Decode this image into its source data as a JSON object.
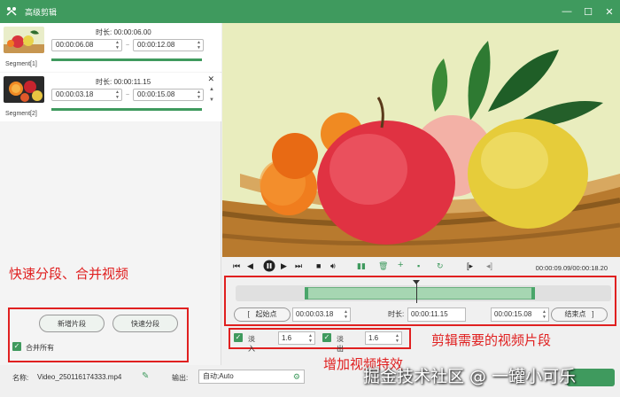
{
  "window": {
    "title": "高级剪辑",
    "controls": [
      "—",
      "☐",
      "✕"
    ]
  },
  "segments": [
    {
      "label": "Segment[1]",
      "duration_label": "时长:",
      "duration": "00:00:06.00",
      "start": "00:00:06.08",
      "end": "00:00:12.08"
    },
    {
      "label": "Segment[2]",
      "duration_label": "时长:",
      "duration": "00:00:11.15",
      "start": "00:00:03.18",
      "end": "00:00:15.08"
    }
  ],
  "left_panel": {
    "caption": "快速分段、合并视频",
    "add_segment": "新增片段",
    "quick_split": "快速分段",
    "merge_all": "合并所有"
  },
  "player": {
    "time_display": "00:00:09.09/00:00:18.20"
  },
  "trim": {
    "start_label": "起始点",
    "start_value": "00:00:03.18",
    "duration_label": "时长:",
    "duration_value": "00:00:11.15",
    "end_value": "00:00:15.08",
    "end_label": "结束点",
    "bracket_left": "[",
    "bracket_right": "]"
  },
  "timeline": {
    "selection_start_fraction": 0.175,
    "selection_end_fraction": 0.83,
    "playhead_fraction": 0.5
  },
  "effects": {
    "fade_in_label": "淡入",
    "fade_in_value": "1.6",
    "fade_out_label": "淡出",
    "fade_out_value": "1.6"
  },
  "annotations": {
    "trim_caption": "剪辑需要的视频片段",
    "effects_caption": "增加视频特效"
  },
  "bottom": {
    "name_label": "名称:",
    "name_value": "Video_250116174333.mp4",
    "output_label": "输出:",
    "output_value": "自动;Auto"
  },
  "watermark": "掘金技术社区 @ 一罐小可乐",
  "colors": {
    "accent": "#3f9a5e",
    "annotation": "#e02020"
  }
}
